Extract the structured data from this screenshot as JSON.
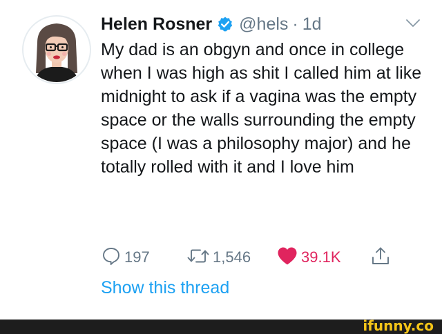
{
  "tweet": {
    "display_name": "Helen Rosner",
    "handle": "@hels",
    "separator": "·",
    "time": "1d",
    "text": "My dad is an obgyn and once in college when I was high as shit I called him at like midnight to ask if a vagina was the empty space or the walls surrounding the empty space (I was a philosophy major) and he totally rolled with it and I love him",
    "actions": {
      "replies": "197",
      "retweets": "1,546",
      "likes": "39.1K"
    },
    "show_thread": "Show this thread"
  },
  "colors": {
    "link": "#1da1f2",
    "like": "#e0245e",
    "muted": "#657786",
    "text": "#14171a"
  },
  "icons": [
    "verified-badge-icon",
    "chevron-down-icon",
    "reply-icon",
    "retweet-icon",
    "heart-icon",
    "share-icon"
  ],
  "watermark": "ifunny.co"
}
